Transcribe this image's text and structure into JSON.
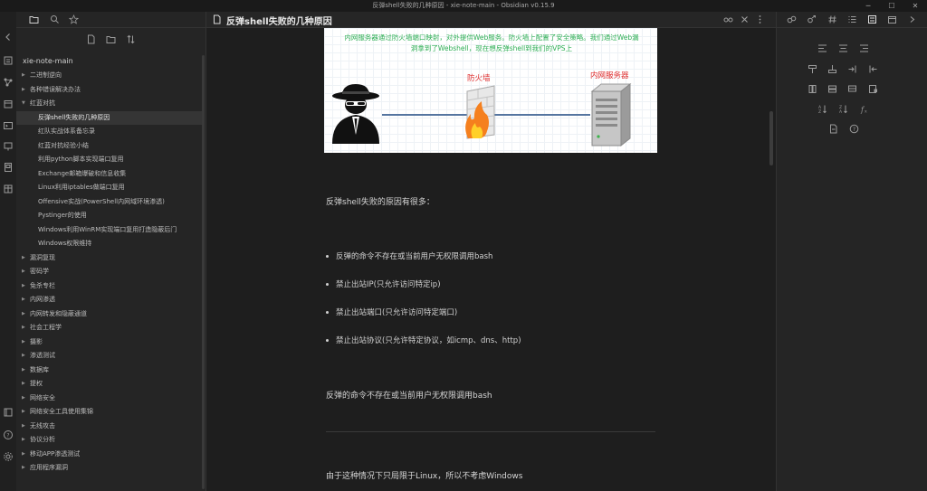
{
  "window": {
    "title": "反弹shell失败的几种原因 - xie-note-main - Obsidian v0.15.9",
    "controls": [
      "minimize-icon",
      "maximize-icon",
      "close-icon"
    ]
  },
  "sidebar": {
    "vault_name": "xie-note-main",
    "items": [
      {
        "label": "二进制逆向",
        "type": "folder",
        "expanded": false
      },
      {
        "label": "各种错误解决办法",
        "type": "folder",
        "expanded": false
      },
      {
        "label": "红蓝对抗",
        "type": "folder",
        "expanded": true
      },
      {
        "label": "反弹shell失败的几种原因",
        "type": "file",
        "active": true
      },
      {
        "label": "红队实战体系备忘录",
        "type": "file"
      },
      {
        "label": "红蓝对抗经验小结",
        "type": "file"
      },
      {
        "label": "利用python脚本实现端口复用",
        "type": "file"
      },
      {
        "label": "Exchange邮箱爆破和信息收集",
        "type": "file"
      },
      {
        "label": "Linux利用iptables做端口复用",
        "type": "file"
      },
      {
        "label": "Offensive实战(PowerShell内网域环境渗透)",
        "type": "file"
      },
      {
        "label": "Pystinger的使用",
        "type": "file"
      },
      {
        "label": "Windows利用WinRM实现端口复用打造隐蔽后门",
        "type": "file"
      },
      {
        "label": "Windows权限维持",
        "type": "file"
      },
      {
        "label": "漏洞复现",
        "type": "folder"
      },
      {
        "label": "密码学",
        "type": "folder"
      },
      {
        "label": "免杀专栏",
        "type": "folder"
      },
      {
        "label": "内网渗透",
        "type": "folder"
      },
      {
        "label": "内网转发和隐蔽通道",
        "type": "folder"
      },
      {
        "label": "社会工程学",
        "type": "folder"
      },
      {
        "label": "摄影",
        "type": "folder"
      },
      {
        "label": "渗透测试",
        "type": "folder"
      },
      {
        "label": "数据库",
        "type": "folder"
      },
      {
        "label": "提权",
        "type": "folder"
      },
      {
        "label": "网络安全",
        "type": "folder"
      },
      {
        "label": "网络安全工具使用集锦",
        "type": "folder"
      },
      {
        "label": "无线攻击",
        "type": "folder"
      },
      {
        "label": "协议分析",
        "type": "folder"
      },
      {
        "label": "移动APP渗透测试",
        "type": "folder"
      },
      {
        "label": "应用程序漏洞",
        "type": "folder"
      }
    ]
  },
  "note": {
    "title": "反弹shell失败的几种原因",
    "diagram": {
      "caption": "内网服务器通过防火墙端口映射，对外提供Web服务。防火墙上配置了安全策略。我们通过Web漏洞拿到了Webshell，现在想反弹shell到我们的VPS上",
      "firewall_label": "防火墙",
      "server_label": "内网服务器"
    },
    "intro": "反弹shell失败的原因有很多：",
    "bullets": [
      "反弹的命令不存在或当前用户无权限调用bash",
      "禁止出站IP(只允许访问特定ip)",
      "禁止出站端口(只允许访问特定端口)",
      "禁止出站协议(只允许特定协议，如icmp、dns、http)"
    ],
    "heading2": "反弹的命令不存在或当前用户无权限调用bash",
    "para_bottom": "由于这种情况下只局限于Linux，所以不考虑Windows"
  },
  "colors": {
    "caption_green": "#2faf55",
    "label_red": "#e03030",
    "bg_main": "#1e1e1e",
    "bg_sidebar": "#252525"
  }
}
